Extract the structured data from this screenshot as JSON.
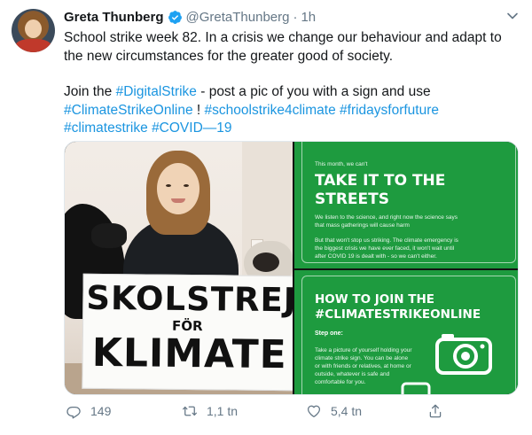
{
  "tweet": {
    "author_name": "Greta Thunberg",
    "handle": "@GretaThunberg",
    "separator": "·",
    "time": "1h",
    "paragraph1": "School strike week 82. In a crisis we change our behaviour and adapt to the new circumstances for the greater good of society.",
    "p2_text1": "Join the ",
    "p2_tag1": "#DigitalStrike",
    "p2_text2": " - post a pic of you with a sign and use ",
    "p2_tag2": "#ClimateStrikeOnline",
    "p2_text3": " ! ",
    "p2_tag3": "#schoolstrike4climate",
    "p2_tag4": "#fridaysforfuture",
    "p2_tag5": "#climatestrike",
    "p2_tag6": "#COVID—19"
  },
  "photo": {
    "sign_line1": "SKOLSTREJ",
    "sign_line2": "FÖR",
    "sign_line3": "KLIMATE"
  },
  "card_top": {
    "kicker": "This month, we can't",
    "headline1": "TAKE IT TO THE",
    "headline2": "STREETS",
    "body1a": "We listen to the science, and right now the science says",
    "body1b": "that mass gatherings will cause harm",
    "body2a": "But that won't stop us striking. The climate emergency is",
    "body2b": "the biggest crisis we have ever faced, it won't wait until",
    "body2c": "after COVID 19 is dealt with - so we can't either."
  },
  "card_bottom": {
    "headline1": "HOW TO JOIN THE",
    "headline2": "#CLIMATESTRIKEONLINE",
    "step": "Step one:",
    "body1": "Take a picture of yourself holding your",
    "body2": "climate strike sign. You can be alone",
    "body3": "or with friends or relatives, at home or",
    "body4": "outside, whatever is safe and",
    "body5": "comfortable for you."
  },
  "actions": {
    "replies": "149",
    "retweets": "1,1 tn",
    "likes": "5,4 tn"
  },
  "colors": {
    "link": "#1b95e0",
    "muted": "#657786",
    "card_green": "#1e9b3f",
    "verified": "#1da1f2"
  }
}
